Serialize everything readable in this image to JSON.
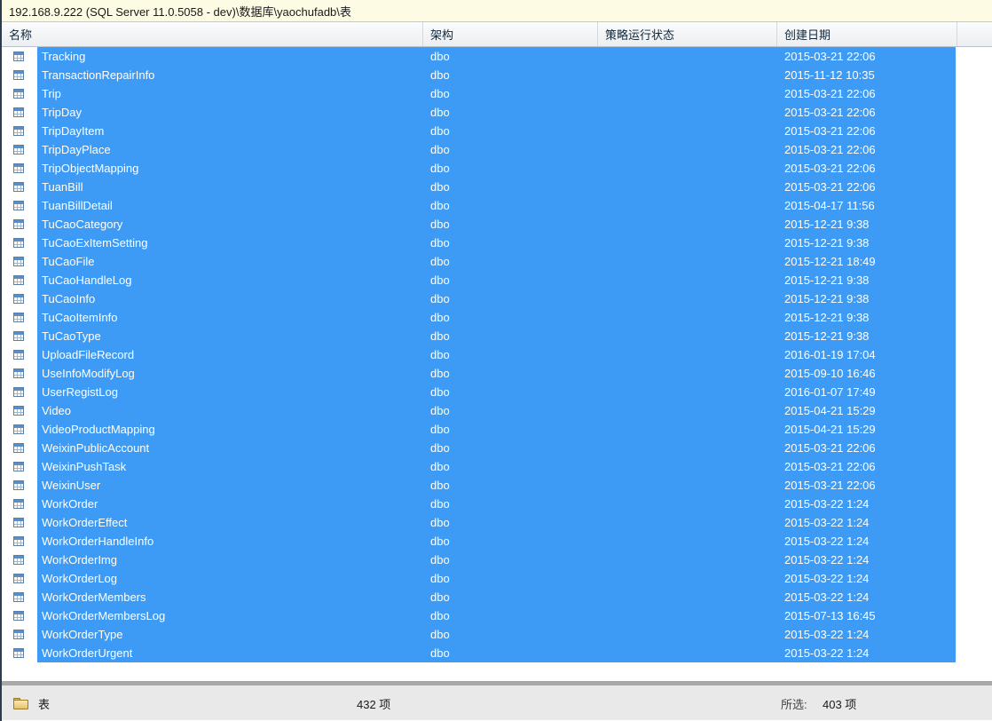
{
  "pathbar": {
    "text": "192.168.9.222 (SQL Server 11.0.5058 - dev)\\数据库\\yaochufadb\\表"
  },
  "columns": [
    {
      "label": "名称"
    },
    {
      "label": "架构"
    },
    {
      "label": "策略运行状态"
    },
    {
      "label": "创建日期"
    }
  ],
  "colors": {
    "selection": "#3d9bf5",
    "pathbar_bg": "#fdfbe4",
    "statusbar_bg": "#e9e9e9"
  },
  "rows": [
    {
      "icon": "table-icon",
      "name": "Tracking",
      "schema": "dbo",
      "policy": "",
      "created": "2015-03-21 22:06"
    },
    {
      "icon": "table-icon",
      "name": "TransactionRepairInfo",
      "schema": "dbo",
      "policy": "",
      "created": "2015-11-12 10:35"
    },
    {
      "icon": "table-icon",
      "name": "Trip",
      "schema": "dbo",
      "policy": "",
      "created": "2015-03-21 22:06"
    },
    {
      "icon": "table-icon",
      "name": "TripDay",
      "schema": "dbo",
      "policy": "",
      "created": "2015-03-21 22:06"
    },
    {
      "icon": "table-icon",
      "name": "TripDayItem",
      "schema": "dbo",
      "policy": "",
      "created": "2015-03-21 22:06"
    },
    {
      "icon": "table-icon",
      "name": "TripDayPlace",
      "schema": "dbo",
      "policy": "",
      "created": "2015-03-21 22:06"
    },
    {
      "icon": "table-icon",
      "name": "TripObjectMapping",
      "schema": "dbo",
      "policy": "",
      "created": "2015-03-21 22:06"
    },
    {
      "icon": "table-icon",
      "name": "TuanBill",
      "schema": "dbo",
      "policy": "",
      "created": "2015-03-21 22:06"
    },
    {
      "icon": "table-icon",
      "name": "TuanBillDetail",
      "schema": "dbo",
      "policy": "",
      "created": "2015-04-17 11:56"
    },
    {
      "icon": "table-icon",
      "name": "TuCaoCategory",
      "schema": "dbo",
      "policy": "",
      "created": "2015-12-21 9:38"
    },
    {
      "icon": "table-icon",
      "name": "TuCaoExItemSetting",
      "schema": "dbo",
      "policy": "",
      "created": "2015-12-21 9:38"
    },
    {
      "icon": "table-icon",
      "name": "TuCaoFile",
      "schema": "dbo",
      "policy": "",
      "created": "2015-12-21 18:49"
    },
    {
      "icon": "table-icon",
      "name": "TuCaoHandleLog",
      "schema": "dbo",
      "policy": "",
      "created": "2015-12-21 9:38"
    },
    {
      "icon": "table-icon",
      "name": "TuCaoInfo",
      "schema": "dbo",
      "policy": "",
      "created": "2015-12-21 9:38"
    },
    {
      "icon": "table-icon",
      "name": "TuCaoItemInfo",
      "schema": "dbo",
      "policy": "",
      "created": "2015-12-21 9:38"
    },
    {
      "icon": "table-icon",
      "name": "TuCaoType",
      "schema": "dbo",
      "policy": "",
      "created": "2015-12-21 9:38"
    },
    {
      "icon": "table-icon",
      "name": "UploadFileRecord",
      "schema": "dbo",
      "policy": "",
      "created": "2016-01-19 17:04"
    },
    {
      "icon": "table-icon",
      "name": "UseInfoModifyLog",
      "schema": "dbo",
      "policy": "",
      "created": "2015-09-10 16:46"
    },
    {
      "icon": "table-icon",
      "name": "UserRegistLog",
      "schema": "dbo",
      "policy": "",
      "created": "2016-01-07 17:49"
    },
    {
      "icon": "table-icon",
      "name": "Video",
      "schema": "dbo",
      "policy": "",
      "created": "2015-04-21 15:29"
    },
    {
      "icon": "table-icon",
      "name": "VideoProductMapping",
      "schema": "dbo",
      "policy": "",
      "created": "2015-04-21 15:29"
    },
    {
      "icon": "table-icon",
      "name": "WeixinPublicAccount",
      "schema": "dbo",
      "policy": "",
      "created": "2015-03-21 22:06"
    },
    {
      "icon": "table-icon",
      "name": "WeixinPushTask",
      "schema": "dbo",
      "policy": "",
      "created": "2015-03-21 22:06"
    },
    {
      "icon": "table-icon",
      "name": "WeixinUser",
      "schema": "dbo",
      "policy": "",
      "created": "2015-03-21 22:06"
    },
    {
      "icon": "table-icon",
      "name": "WorkOrder",
      "schema": "dbo",
      "policy": "",
      "created": "2015-03-22 1:24"
    },
    {
      "icon": "table-icon",
      "name": "WorkOrderEffect",
      "schema": "dbo",
      "policy": "",
      "created": "2015-03-22 1:24"
    },
    {
      "icon": "table-icon",
      "name": "WorkOrderHandleInfo",
      "schema": "dbo",
      "policy": "",
      "created": "2015-03-22 1:24"
    },
    {
      "icon": "table-icon",
      "name": "WorkOrderImg",
      "schema": "dbo",
      "policy": "",
      "created": "2015-03-22 1:24"
    },
    {
      "icon": "table-icon",
      "name": "WorkOrderLog",
      "schema": "dbo",
      "policy": "",
      "created": "2015-03-22 1:24"
    },
    {
      "icon": "table-icon",
      "name": "WorkOrderMembers",
      "schema": "dbo",
      "policy": "",
      "created": "2015-03-22 1:24"
    },
    {
      "icon": "table-icon",
      "name": "WorkOrderMembersLog",
      "schema": "dbo",
      "policy": "",
      "created": "2015-07-13 16:45"
    },
    {
      "icon": "table-icon",
      "name": "WorkOrderType",
      "schema": "dbo",
      "policy": "",
      "created": "2015-03-22 1:24"
    },
    {
      "icon": "table-icon",
      "name": "WorkOrderUrgent",
      "schema": "dbo",
      "policy": "",
      "created": "2015-03-22 1:24"
    }
  ],
  "statusbar": {
    "folder_icon": "folder-icon",
    "label": "表",
    "count": "432 项",
    "selected_label": "所选:",
    "selected_count": "403 项"
  }
}
